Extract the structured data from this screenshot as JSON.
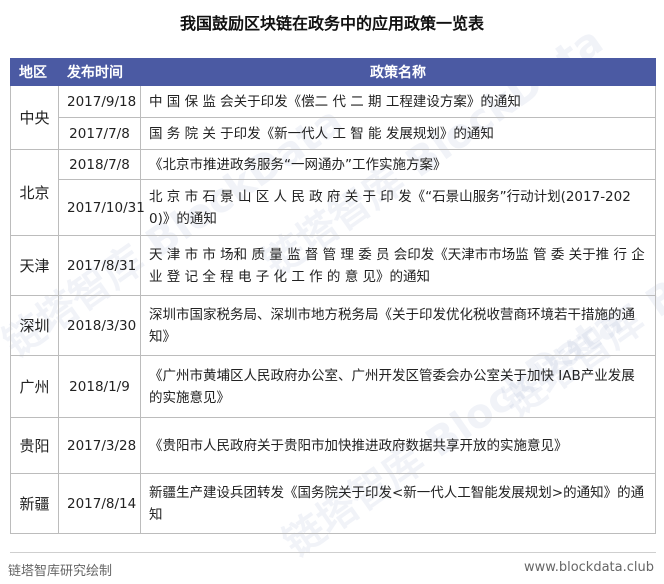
{
  "title": "我国鼓励区块链在政务中的应用政策一览表",
  "headers": {
    "region": "地区",
    "date": "发布时间",
    "name": "政策名称"
  },
  "rows": [
    {
      "region": "中央",
      "date": "2017/9/18",
      "name": "中 国 保 监 会关于印发《偿二 代 二 期 工程建设方案》的通知"
    },
    {
      "region": "",
      "date": "2017/7/8",
      "name": "国 务 院 关 于印发《新一代人 工 智 能 发展规划》的通知"
    },
    {
      "region": "北京",
      "date": "2018/7/8",
      "name": "《北京市推进政务服务“一网通办”工作实施方案》"
    },
    {
      "region": "",
      "date": "2017/10/31",
      "name": "北 京 市 石 景 山 区 人 民 政 府 关 于 印 发《“石景山服务”行动计划(2017-2020)》的通知"
    },
    {
      "region": "天津",
      "date": "2017/8/31",
      "name": "天 津 市 市 场和 质 量 监 督 管 理 委 员 会印发《天津市市场监 管 委 关于推 行 企 业 登 记 全 程 电 子 化 工 作 的 意 见》的通知"
    },
    {
      "region": "深圳",
      "date": "2018/3/30",
      "name": "深圳市国家税务局、深圳市地方税务局《关于印发优化税收营商环境若干措施的通知》"
    },
    {
      "region": "广州",
      "date": "2018/1/9",
      "name": "《广州市黄埔区人民政府办公室、广州开发区管委会办公室关于加快 IAB产业发展的实施意见》"
    },
    {
      "region": "贵阳",
      "date": "2017/3/28",
      "name": "《贵阳市人民政府关于贵阳市加快推进政府数据共享开放的实施意见》"
    },
    {
      "region": "新疆",
      "date": "2017/8/14",
      "name": "新疆生产建设兵团转发《国务院关于印发<新一代人工智能发展规划>的通知》的通知"
    }
  ],
  "source": "链塔智库研究绘制",
  "site": "www.blockdata.club",
  "watermark": "链塔智库 BlockData"
}
